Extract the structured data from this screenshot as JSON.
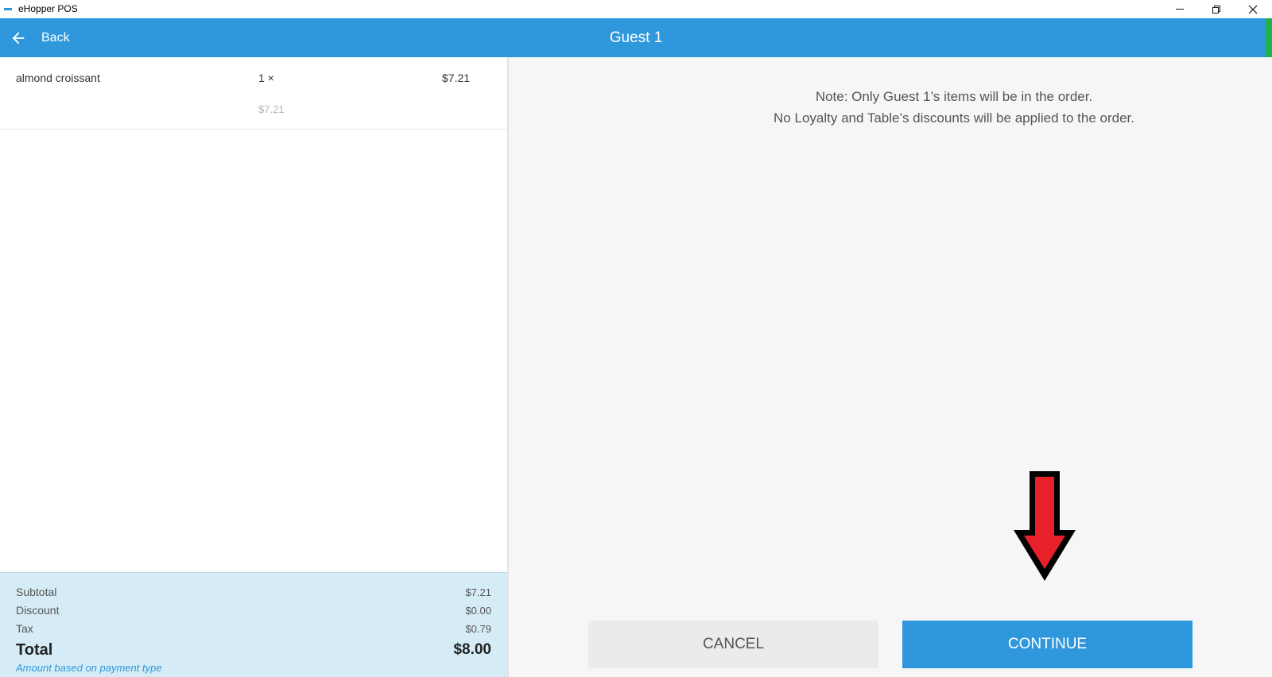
{
  "window": {
    "title": "eHopper POS"
  },
  "header": {
    "back_label": "Back",
    "title": "Guest 1"
  },
  "order": {
    "items": [
      {
        "name": "almond croissant",
        "qty": "1 ×",
        "price": "$7.21",
        "unit_price": "$7.21"
      }
    ],
    "totals": {
      "subtotal_label": "Subtotal",
      "subtotal": "$7.21",
      "discount_label": "Discount",
      "discount": "$0.00",
      "tax_label": "Tax",
      "tax": "$0.79",
      "total_label": "Total",
      "total": "$8.00",
      "note": "Amount based on payment type"
    }
  },
  "main": {
    "note_line1": "Note: Only Guest 1’s items will be in the order.",
    "note_line2": "No Loyalty and Table’s discounts will be applied to the order.",
    "cancel_label": "CANCEL",
    "continue_label": "CONTINUE"
  },
  "colors": {
    "brand": "#2f98dc",
    "totals_bg": "#d5ecf6",
    "annotation_arrow": "#e8202a"
  }
}
